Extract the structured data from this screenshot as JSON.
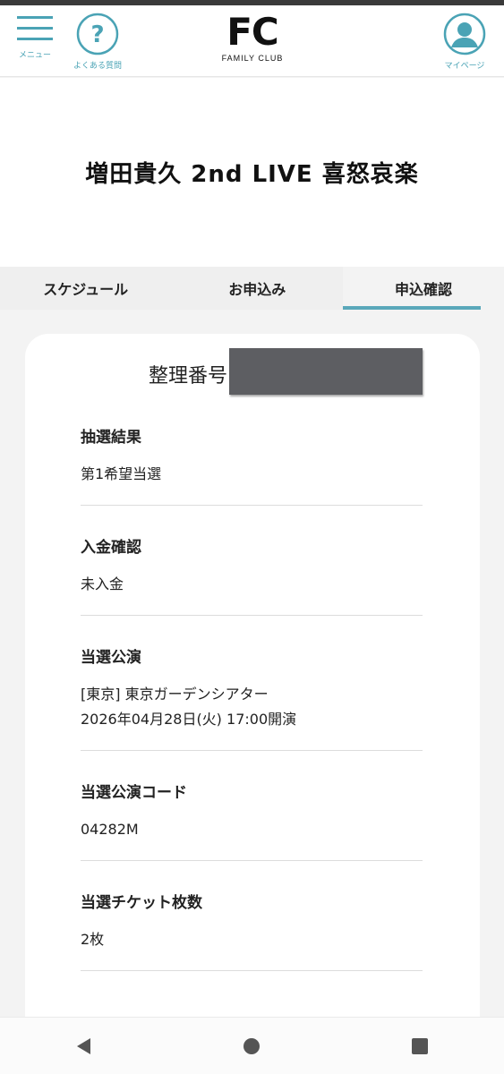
{
  "header": {
    "menu_label": "メニュー",
    "faq_label": "よくある質問",
    "mypage_label": "マイページ",
    "logo_mark": "FC",
    "logo_sub": "FAMILY CLUB"
  },
  "title": "増田貴久 2nd LIVE 喜怒哀楽",
  "tabs": [
    {
      "label": "スケジュール"
    },
    {
      "label": "お申込み"
    },
    {
      "label": "申込確認"
    }
  ],
  "card": {
    "ref_label": "整理番号",
    "items": [
      {
        "label": "抽選結果",
        "value": "第1希望当選"
      },
      {
        "label": "入金確認",
        "value": "未入金"
      },
      {
        "label": "当選公演",
        "value": "[東京] 東京ガーデンシアター",
        "value2": "2026年04月28日(火) 17:00開演"
      },
      {
        "label": "当選公演コード",
        "value": "04282M"
      },
      {
        "label": "当選チケット枚数",
        "value": "2枚"
      }
    ]
  },
  "colors": {
    "accent": "#4aa3b5",
    "redaction": "#5d5e62"
  },
  "icons": {
    "menu": "hamburger-icon",
    "faq": "question-mark-icon",
    "mypage": "user-icon",
    "nav_back": "back-triangle-icon",
    "nav_home": "home-circle-icon",
    "nav_recents": "recents-square-icon"
  }
}
